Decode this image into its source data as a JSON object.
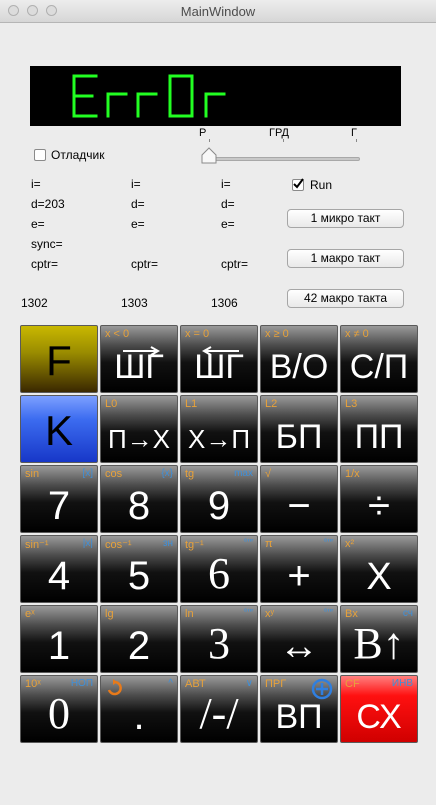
{
  "window": {
    "title": "MainWindow"
  },
  "display": {
    "text": "ErrOr",
    "color": "#22ff22"
  },
  "angle": {
    "labels": [
      "Р",
      "ГРД",
      "Г"
    ],
    "selected": "Р"
  },
  "debug": {
    "label": "Отладчик",
    "checked": false
  },
  "run": {
    "label": "Run",
    "checked": true
  },
  "registers": {
    "col1": {
      "i": "i=",
      "d": "d=203",
      "e": "e=",
      "sync": "sync=",
      "cptr": "cptr=",
      "addr": "1302"
    },
    "col2": {
      "i": "i=",
      "d": "d=",
      "e": "e=",
      "cptr": "cptr=",
      "addr": "1303"
    },
    "col3": {
      "i": "i=",
      "d": "d=",
      "e": "e=",
      "cptr": "cptr=",
      "addr": "1306"
    }
  },
  "buttons": {
    "micro": "1 микро такт",
    "macro": "1 макро такт",
    "macro42": "42 макро такта"
  },
  "keys": [
    {
      "id": "f",
      "main": "F",
      "alt": "",
      "blue": ""
    },
    {
      "id": "step-fwd",
      "main": "ШГ",
      "alt": "x < 0",
      "blue": ""
    },
    {
      "id": "step-back",
      "main": "ШГ",
      "alt": "x = 0",
      "blue": ""
    },
    {
      "id": "bo",
      "main": "В/О",
      "alt": "x ≥ 0",
      "blue": ""
    },
    {
      "id": "sp",
      "main": "С/П",
      "alt": "x ≠ 0",
      "blue": ""
    },
    {
      "id": "k",
      "main": "K",
      "alt": "",
      "blue": ""
    },
    {
      "id": "p-to-x",
      "main": "П→Х",
      "alt": "L0",
      "blue": ""
    },
    {
      "id": "x-to-p",
      "main": "Х→П",
      "alt": "L1",
      "blue": ""
    },
    {
      "id": "bp",
      "main": "БП",
      "alt": "L2",
      "blue": ""
    },
    {
      "id": "pp",
      "main": "ПП",
      "alt": "L3",
      "blue": ""
    },
    {
      "id": "7",
      "main": "7",
      "alt": "sin",
      "blue": "[x]"
    },
    {
      "id": "8",
      "main": "8",
      "alt": "cos",
      "blue": "{x}"
    },
    {
      "id": "9",
      "main": "9",
      "alt": "tg",
      "blue": "max"
    },
    {
      "id": "minus",
      "main": "−",
      "alt": "√",
      "blue": ""
    },
    {
      "id": "divide",
      "main": "÷",
      "alt": "1/x",
      "blue": ""
    },
    {
      "id": "4",
      "main": "4",
      "alt": "sin⁻¹",
      "blue": "|x|"
    },
    {
      "id": "5",
      "main": "5",
      "alt": "cos⁻¹",
      "blue": "зн"
    },
    {
      "id": "6",
      "main": "6",
      "alt": "tg⁻¹",
      "blue": "°′″"
    },
    {
      "id": "plus",
      "main": "+",
      "alt": "π",
      "blue": "°′″"
    },
    {
      "id": "multiply",
      "main": "X",
      "alt": "x²",
      "blue": ""
    },
    {
      "id": "1",
      "main": "1",
      "alt": "eˣ",
      "blue": ""
    },
    {
      "id": "2",
      "main": "2",
      "alt": "lg",
      "blue": ""
    },
    {
      "id": "3",
      "main": "3",
      "alt": "ln",
      "blue": "°′″"
    },
    {
      "id": "swap",
      "main": "↔",
      "alt": "xʸ",
      "blue": "°′″"
    },
    {
      "id": "enter",
      "main": "В↑",
      "alt": "Вx",
      "blue": "сч"
    },
    {
      "id": "0",
      "main": "0",
      "alt": "10ˣ",
      "blue": "НОП"
    },
    {
      "id": "dot",
      "main": ".",
      "alt": "",
      "blue": "^"
    },
    {
      "id": "sign",
      "main": "/-/",
      "alt": "АВТ",
      "blue": "∨"
    },
    {
      "id": "vp",
      "main": "ВП",
      "alt": "ПРГ",
      "blue": ""
    },
    {
      "id": "cx",
      "main": "СХ",
      "alt": "CF",
      "blue": "ИНВ"
    }
  ],
  "colors": {
    "f_key": "#b0a000",
    "k_key": "#2d5ce6",
    "cx_key": "#e00000",
    "accent_orange": "#e8a23a",
    "accent_blue": "#3f8fd8"
  }
}
